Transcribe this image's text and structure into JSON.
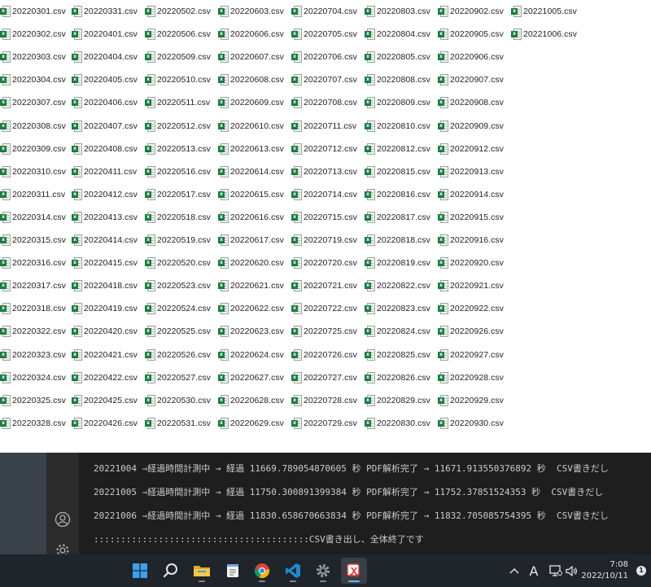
{
  "explorer": {
    "columns": [
      [
        "20220301.csv",
        "20220302.csv",
        "20220303.csv",
        "20220304.csv",
        "20220307.csv",
        "20220308.csv",
        "20220309.csv",
        "20220310.csv",
        "20220311.csv",
        "20220314.csv",
        "20220315.csv",
        "20220316.csv",
        "20220317.csv",
        "20220318.csv",
        "20220322.csv",
        "20220323.csv",
        "20220324.csv",
        "20220325.csv",
        "20220328.csv"
      ],
      [
        "20220331.csv",
        "20220401.csv",
        "20220404.csv",
        "20220405.csv",
        "20220406.csv",
        "20220407.csv",
        "20220408.csv",
        "20220411.csv",
        "20220412.csv",
        "20220413.csv",
        "20220414.csv",
        "20220415.csv",
        "20220418.csv",
        "20220419.csv",
        "20220420.csv",
        "20220421.csv",
        "20220422.csv",
        "20220425.csv",
        "20220426.csv"
      ],
      [
        "20220502.csv",
        "20220506.csv",
        "20220509.csv",
        "20220510.csv",
        "20220511.csv",
        "20220512.csv",
        "20220513.csv",
        "20220516.csv",
        "20220517.csv",
        "20220518.csv",
        "20220519.csv",
        "20220520.csv",
        "20220523.csv",
        "20220524.csv",
        "20220525.csv",
        "20220526.csv",
        "20220527.csv",
        "20220530.csv",
        "20220531.csv"
      ],
      [
        "20220603.csv",
        "20220606.csv",
        "20220607.csv",
        "20220608.csv",
        "20220609.csv",
        "20220610.csv",
        "20220613.csv",
        "20220614.csv",
        "20220615.csv",
        "20220616.csv",
        "20220617.csv",
        "20220620.csv",
        "20220621.csv",
        "20220622.csv",
        "20220623.csv",
        "20220624.csv",
        "20220627.csv",
        "20220628.csv",
        "20220629.csv"
      ],
      [
        "20220704.csv",
        "20220705.csv",
        "20220706.csv",
        "20220707.csv",
        "20220708.csv",
        "20220711.csv",
        "20220712.csv",
        "20220713.csv",
        "20220714.csv",
        "20220715.csv",
        "20220719.csv",
        "20220720.csv",
        "20220721.csv",
        "20220722.csv",
        "20220725.csv",
        "20220726.csv",
        "20220727.csv",
        "20220728.csv",
        "20220729.csv"
      ],
      [
        "20220803.csv",
        "20220804.csv",
        "20220805.csv",
        "20220808.csv",
        "20220809.csv",
        "20220810.csv",
        "20220812.csv",
        "20220815.csv",
        "20220816.csv",
        "20220817.csv",
        "20220818.csv",
        "20220819.csv",
        "20220822.csv",
        "20220823.csv",
        "20220824.csv",
        "20220825.csv",
        "20220826.csv",
        "20220829.csv",
        "20220830.csv"
      ],
      [
        "20220902.csv",
        "20220905.csv",
        "20220906.csv",
        "20220907.csv",
        "20220908.csv",
        "20220909.csv",
        "20220912.csv",
        "20220913.csv",
        "20220914.csv",
        "20220915.csv",
        "20220916.csv",
        "20220920.csv",
        "20220921.csv",
        "20220922.csv",
        "20220926.csv",
        "20220927.csv",
        "20220928.csv",
        "20220929.csv",
        "20220930.csv"
      ],
      [
        "20221005.csv",
        "20221006.csv"
      ]
    ],
    "file_icon": "excel-csv-icon"
  },
  "terminal": {
    "lines": [
      "20221004 ⇒経過時間計測中 → 経過 11669.789054870605 秒 PDF解析完了 → 11671.913550376892 秒  CSV書きだし",
      "20221005 ⇒経過時間計測中 → 経過 11750.300891399384 秒 PDF解析完了 → 11752.37851524353 秒  CSV書きだし",
      "20221006 ⇒経過時間計測中 → 経過 11830.658670663834 秒 PDF解析完了 → 11832.705085754395 秒  CSV書きだし",
      "::::::::::::::::::::::::::::::::::::::::CSV書き出し、全体終了です"
    ]
  },
  "side_panel": {
    "icons": [
      "account-icon",
      "settings-gear-icon"
    ]
  },
  "taskbar": {
    "apps": [
      {
        "name": "start-button",
        "icon": "windows-logo-icon"
      },
      {
        "name": "search-button",
        "icon": "search-icon"
      },
      {
        "name": "file-explorer-app",
        "icon": "folder-icon"
      },
      {
        "name": "notepad-app",
        "icon": "notepad-icon"
      },
      {
        "name": "chrome-app",
        "icon": "chrome-icon"
      },
      {
        "name": "vscode-app",
        "icon": "vscode-icon"
      },
      {
        "name": "settings-app",
        "icon": "gear-icon"
      },
      {
        "name": "snipping-tool-app",
        "icon": "snipping-icon"
      }
    ],
    "tray": {
      "ime_label": "A",
      "time": "7:08",
      "date": "2022/10/11",
      "notification_count": "1"
    }
  },
  "colors": {
    "terminal_bg": "#1e1e1e",
    "terminal_text": "#cccccc",
    "taskbar_bg": "#20252b",
    "excel_green": "#1d7a44"
  }
}
